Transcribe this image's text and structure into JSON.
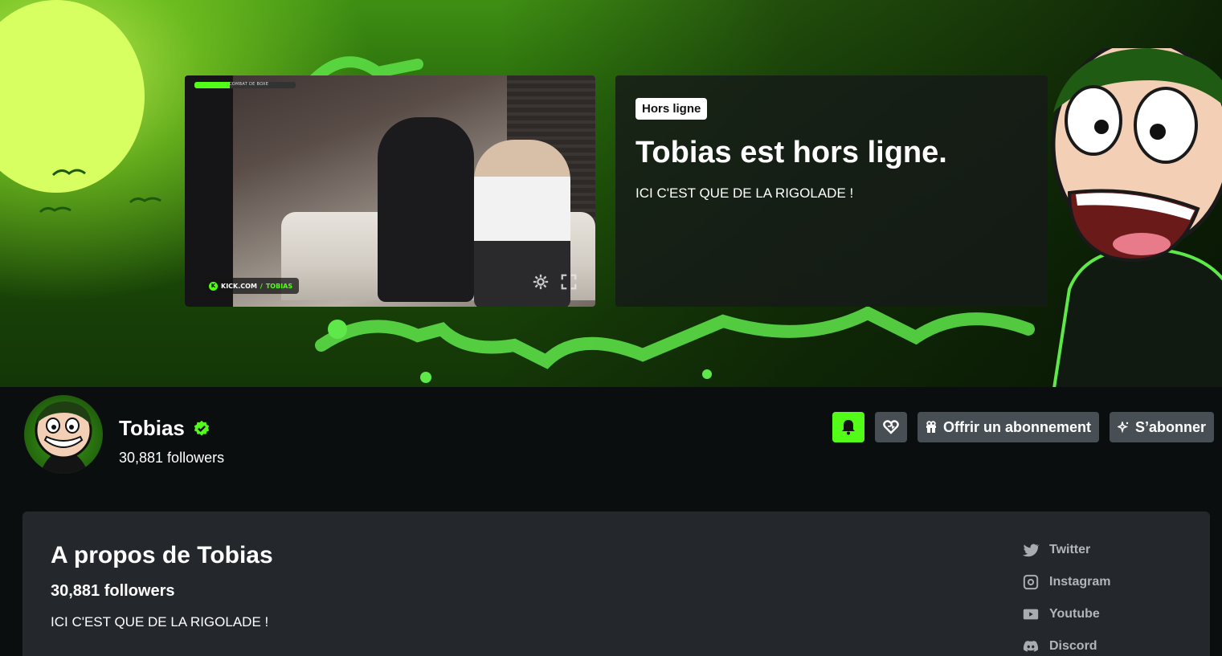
{
  "banner": {
    "status_pill": "Hors ligne",
    "offline_title": "Tobias est hors ligne.",
    "offline_description": "ICI C'EST QUE DE LA RIGOLADE !",
    "preview": {
      "hud_label": "COMBAT DE BOXE",
      "watermark_prefix": "KICK.COM",
      "watermark_slash": "/",
      "watermark_channel": "TOBIAS",
      "settings_icon": "gear-icon",
      "fullscreen_icon": "fullscreen-icon"
    }
  },
  "channel": {
    "name": "Tobias",
    "verified": true,
    "followers_text": "30,881 followers"
  },
  "actions": {
    "bell_icon": "bell-icon",
    "heart_icon": "heart-icon",
    "gift_label": "Offrir un abonnement",
    "subscribe_label": "S’abonner"
  },
  "about": {
    "title": "A propos de Tobias",
    "followers_text": "30,881 followers",
    "description": "ICI C'EST QUE DE LA RIGOLADE !",
    "socials": [
      {
        "label": "Twitter",
        "icon": "twitter-icon"
      },
      {
        "label": "Instagram",
        "icon": "instagram-icon"
      },
      {
        "label": "Youtube",
        "icon": "youtube-icon"
      },
      {
        "label": "Discord",
        "icon": "discord-icon"
      }
    ]
  },
  "colors": {
    "accent": "#53fc18",
    "page_bg": "#0b0e0f",
    "panel_bg": "#24272c",
    "button_bg": "#474f54"
  }
}
